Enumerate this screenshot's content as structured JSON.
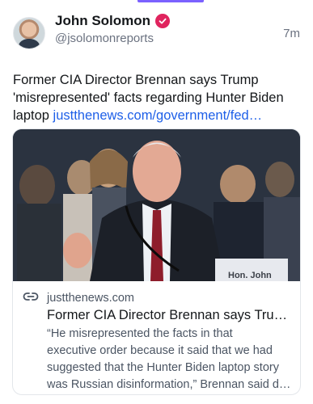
{
  "author": {
    "display_name": "John Solomon",
    "handle": "@jsolomonreports",
    "verified_icon": "verified-badge-icon"
  },
  "post": {
    "timestamp": "7m",
    "text": "Former CIA Director Brennan says Trump 'misrepresented' facts regarding Hunter Biden laptop ",
    "link_text": "justthenews.com/government/fed…"
  },
  "link_card": {
    "domain": "justthenews.com",
    "title": "Former CIA Director Brennan says Tru…",
    "description_lines": [
      "“He misrepresented the facts in that",
      "executive order because it said that we had",
      "suggested that the Hunter Biden laptop story",
      "was Russian disinformation,” Brennan said d…"
    ],
    "nameplate": "Hon. John"
  },
  "colors": {
    "accent": "#7b61ff",
    "link": "#1d5fe8",
    "verified": "#e0245e"
  }
}
